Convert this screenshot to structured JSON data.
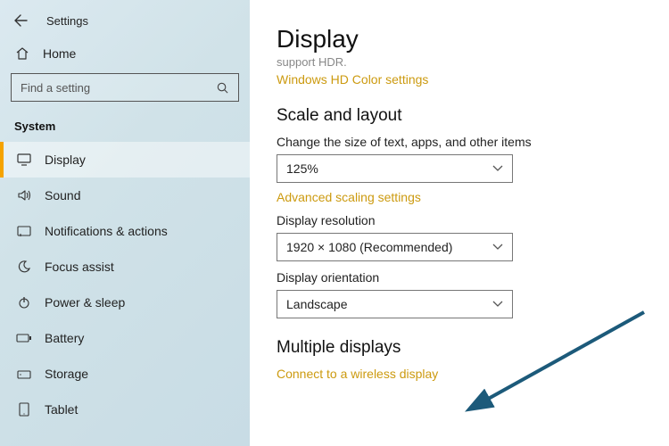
{
  "header": {
    "app_title": "Settings"
  },
  "sidebar": {
    "home_label": "Home",
    "search_placeholder": "Find a setting",
    "section_label": "System",
    "items": [
      {
        "label": "Display"
      },
      {
        "label": "Sound"
      },
      {
        "label": "Notifications & actions"
      },
      {
        "label": "Focus assist"
      },
      {
        "label": "Power & sleep"
      },
      {
        "label": "Battery"
      },
      {
        "label": "Storage"
      },
      {
        "label": "Tablet"
      }
    ]
  },
  "main": {
    "page_title": "Display",
    "hdr_sub": "support HDR.",
    "hdcolor_link": "Windows HD Color settings",
    "scale_heading": "Scale and layout",
    "scale_label": "Change the size of text, apps, and other items",
    "scale_value": "125%",
    "advanced_link": "Advanced scaling settings",
    "resolution_label": "Display resolution",
    "resolution_value": "1920 × 1080 (Recommended)",
    "orientation_label": "Display orientation",
    "orientation_value": "Landscape",
    "multi_heading": "Multiple displays",
    "wireless_link": "Connect to a wireless display"
  },
  "colors": {
    "accent": "#f5a300",
    "link": "#cc9a0f",
    "arrow": "#1c5a7a"
  }
}
